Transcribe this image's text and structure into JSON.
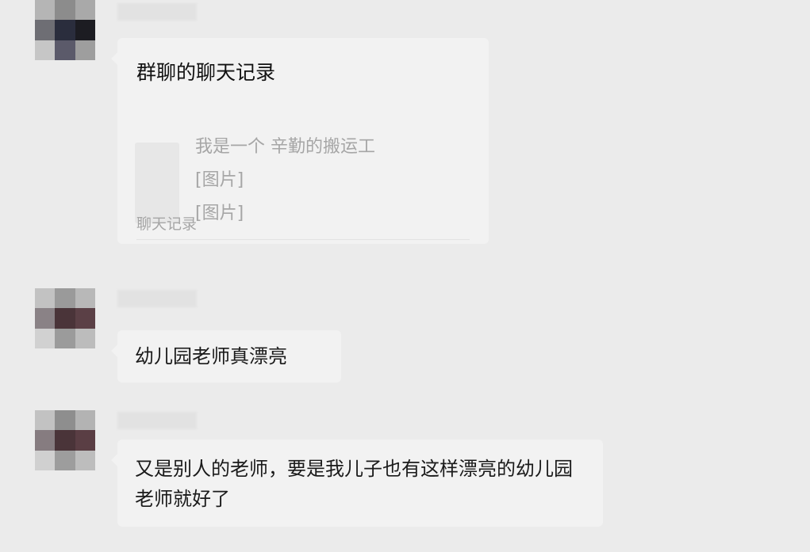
{
  "messages": [
    {
      "type": "chat-record",
      "card_title": "群聊的聊天记录",
      "preview_lines": [
        "我是一个 辛勤的搬运工",
        "[图片]",
        "[图片]"
      ],
      "footer": "聊天记录"
    },
    {
      "type": "text",
      "text": "幼儿园老师真漂亮"
    },
    {
      "type": "text",
      "text": "又是别人的老师，要是我儿子也有这样漂亮的幼儿园老师就好了"
    }
  ],
  "colors": {
    "background": "#ebebeb",
    "bubble": "#f2f2f2",
    "secondary_text": "#a6a6a6"
  },
  "icons": [
    "pixelated-avatar",
    "pixelated-avatar",
    "pixelated-avatar"
  ]
}
